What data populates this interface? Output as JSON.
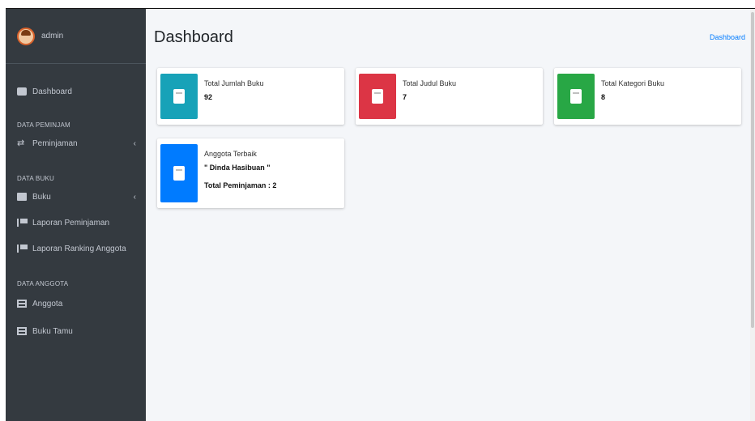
{
  "sidebar": {
    "brand_name": "admin",
    "dashboard_label": "Dashboard",
    "header_pinjam": "DATA PEMINJAM",
    "peminjaman_label": "Peminjaman",
    "header_buku": "DATA BUKU",
    "buku_label": "Buku",
    "laporan_peminjaman_label": "Laporan Peminjaman",
    "laporan_ranking_label": "Laporan Ranking Anggota",
    "header_anggota": "DATA ANGGOTA",
    "anggota_label": "Anggota",
    "buku_tamu_label": "Buku Tamu",
    "chevron": "‹"
  },
  "header": {
    "title": "Dashboard",
    "breadcrumb": "Dashboard"
  },
  "stats": [
    {
      "label": "Total Jumlah Buku",
      "value": "92",
      "color": "#17a2b8",
      "icon": "book-icon"
    },
    {
      "label": "Total Judul Buku",
      "value": "7",
      "color": "#dc3545",
      "icon": "book-icon"
    },
    {
      "label": "Total Kategori Buku",
      "value": "8",
      "color": "#28a745",
      "icon": "book-icon"
    }
  ],
  "top_member": {
    "label": "Anggota Terbaik",
    "name": "\" Dinda Hasibuan \"",
    "total": "Total Peminjaman : 2",
    "color": "#007bff",
    "icon": "book-icon"
  }
}
